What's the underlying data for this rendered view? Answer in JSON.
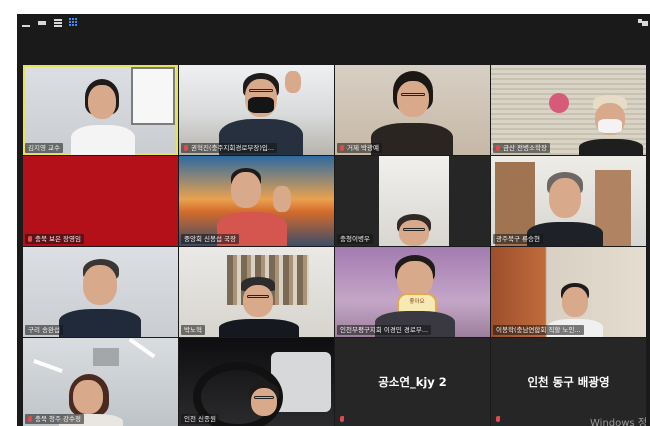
{
  "app": {
    "accent": "#e5e35b",
    "muted_mic_color": "#e14b4b",
    "grid_icon_color": "#3b8bf0"
  },
  "toolbar": {
    "icons": [
      "minimize-icon",
      "restore-icon",
      "list-view-icon",
      "gallery-view-icon",
      "fullscreen-icon"
    ]
  },
  "participants": [
    {
      "name": "김지영 교수",
      "muted": false,
      "active": true
    },
    {
      "name": "권혁진(충주지회경로부장)입...",
      "muted": true,
      "active": false
    },
    {
      "name": "거제 박광예",
      "muted": true,
      "active": false
    },
    {
      "name": "금산 전병소학장",
      "muted": true,
      "active": false
    },
    {
      "name": "충북 보은 장영임",
      "muted": true,
      "active": false
    },
    {
      "name": "중앙회 신봉섭 국장",
      "muted": false,
      "active": false
    },
    {
      "name": "충청이병우",
      "muted": false,
      "active": false
    },
    {
      "name": "광주북구 류승현",
      "muted": false,
      "active": false
    },
    {
      "name": "구리 송완섭",
      "muted": false,
      "active": false
    },
    {
      "name": "박노혁",
      "muted": false,
      "active": false
    },
    {
      "name": "인천부평구지회 이경민 경로부...",
      "muted": false,
      "active": false
    },
    {
      "name": "이봉학(충남연합회 직할 노인...",
      "muted": false,
      "active": false
    },
    {
      "name": "충북 청주 강수정",
      "muted": false,
      "active": false
    },
    {
      "name": "인천 신종원",
      "muted": false,
      "active": false
    },
    {
      "name": "공소연_kjy 2",
      "muted": true,
      "active": false
    },
    {
      "name": "인천 동구 배광영",
      "muted": true,
      "active": false
    }
  ],
  "overlay_text": {
    "sign": "좋아요"
  },
  "watermark": "Windows 정"
}
